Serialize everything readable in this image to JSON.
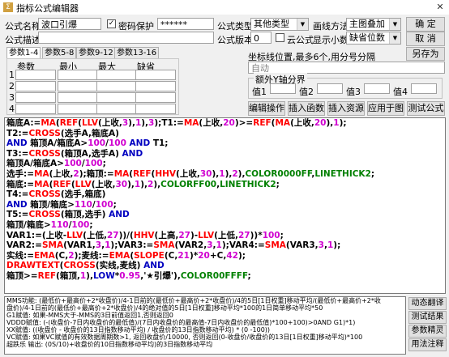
{
  "window": {
    "title": "指标公式编辑器",
    "close": "✕"
  },
  "form": {
    "name_label": "公式名称",
    "name_value": "波口引爆",
    "password_label": "密码保护",
    "password_value": "******",
    "desc_label": "公式描述",
    "desc_value": "",
    "type_label": "公式类型",
    "type_value": "其他类型",
    "draw_label": "画线方法",
    "draw_value": "主图叠加",
    "version_label": "公式版本",
    "version_value": "0",
    "cloud_label": "云公式",
    "decimals_label": "显示小数",
    "decimals_value": "缺省位数"
  },
  "buttons": {
    "ok": "确 定",
    "cancel": "取 消",
    "save_as": "另存为",
    "edit_op": "编辑操作",
    "insert_fn": "插入函数",
    "insert_res": "插入资源",
    "apply_chart": "应用于图",
    "test": "测试公式"
  },
  "tabs": [
    "参数1-4",
    "参数5-8",
    "参数9-12",
    "参数13-16"
  ],
  "params": {
    "headers": [
      "参数",
      "最小",
      "最大",
      "缺省"
    ],
    "rows": [
      "1",
      "2",
      "3",
      "4"
    ]
  },
  "coord": {
    "label": "坐标线位置,最多6个,用分号分隔",
    "value": "自动"
  },
  "extra_y": {
    "label": "额外Y轴分界",
    "values": [
      "值1",
      "值2",
      "值3",
      "值4"
    ]
  },
  "code_lines": [
    [
      [
        "blk",
        "箱底A:="
      ],
      [
        "fn",
        "MA"
      ],
      [
        "blk",
        "("
      ],
      [
        "fn",
        "REF"
      ],
      [
        "blk",
        "("
      ],
      [
        "fn",
        "LLV"
      ],
      [
        "blk",
        "(上收,"
      ],
      [
        "num",
        "3"
      ],
      [
        "blk",
        "),"
      ],
      [
        "num",
        "1"
      ],
      [
        "blk",
        "),"
      ],
      [
        "num",
        "3"
      ],
      [
        "blk",
        ");T1:="
      ],
      [
        "fn",
        "MA"
      ],
      [
        "blk",
        "(上收,"
      ],
      [
        "num",
        "20"
      ],
      [
        "blk",
        ")>="
      ],
      [
        "fn",
        "REF"
      ],
      [
        "blk",
        "("
      ],
      [
        "fn",
        "MA"
      ],
      [
        "blk",
        "(上收,"
      ],
      [
        "num",
        "20"
      ],
      [
        "blk",
        "),"
      ],
      [
        "num",
        "1"
      ],
      [
        "blk",
        ");"
      ]
    ],
    [
      [
        "blk",
        "T2:="
      ],
      [
        "fn",
        "CROSS"
      ],
      [
        "blk",
        "(选手A,箱底A)"
      ]
    ],
    [
      [
        "kw",
        "AND"
      ],
      [
        "blk",
        " 箱顶A/箱底A>"
      ],
      [
        "num",
        "100"
      ],
      [
        "blk",
        "/"
      ],
      [
        "num",
        "100"
      ],
      [
        "blk",
        " "
      ],
      [
        "kw",
        "AND"
      ],
      [
        "blk",
        " T1;"
      ]
    ],
    [
      [
        "blk",
        "T3:="
      ],
      [
        "fn",
        "CROSS"
      ],
      [
        "blk",
        "(箱顶A,选手A) "
      ],
      [
        "kw",
        "AND"
      ]
    ],
    [
      [
        "blk",
        "箱顶A/箱底A>"
      ],
      [
        "num",
        "100"
      ],
      [
        "blk",
        "/"
      ],
      [
        "num",
        "100"
      ],
      [
        "blk",
        ";"
      ]
    ],
    [
      [
        "blk",
        "选手:="
      ],
      [
        "fn",
        "MA"
      ],
      [
        "blk",
        "(上收,"
      ],
      [
        "num",
        "2"
      ],
      [
        "blk",
        ");箱顶:="
      ],
      [
        "fn",
        "MA"
      ],
      [
        "blk",
        "("
      ],
      [
        "fn",
        "REF"
      ],
      [
        "blk",
        "("
      ],
      [
        "fn",
        "HHV"
      ],
      [
        "blk",
        "(上收,"
      ],
      [
        "num",
        "30"
      ],
      [
        "blk",
        "),"
      ],
      [
        "num",
        "1"
      ],
      [
        "blk",
        "),"
      ],
      [
        "num",
        "2"
      ],
      [
        "blk",
        "),"
      ],
      [
        "grn",
        "COLOR0000FF"
      ],
      [
        "blk",
        ","
      ],
      [
        "grn",
        "LINETHICK2"
      ],
      [
        "blk",
        ";"
      ]
    ],
    [
      [
        "blk",
        "箱底:="
      ],
      [
        "fn",
        "MA"
      ],
      [
        "blk",
        "("
      ],
      [
        "fn",
        "REF"
      ],
      [
        "blk",
        "("
      ],
      [
        "fn",
        "LLV"
      ],
      [
        "blk",
        "(上收,"
      ],
      [
        "num",
        "30"
      ],
      [
        "blk",
        "),"
      ],
      [
        "num",
        "1"
      ],
      [
        "blk",
        "),"
      ],
      [
        "num",
        "2"
      ],
      [
        "blk",
        "),"
      ],
      [
        "grn",
        "COLORFF00"
      ],
      [
        "blk",
        ","
      ],
      [
        "grn",
        "LINETHICK2"
      ],
      [
        "blk",
        ";"
      ]
    ],
    [
      [
        "blk",
        "T4:="
      ],
      [
        "fn",
        "CROSS"
      ],
      [
        "blk",
        "(选手,箱底)"
      ]
    ],
    [
      [
        "kw",
        "AND"
      ],
      [
        "blk",
        " 箱顶/箱底>"
      ],
      [
        "num",
        "110"
      ],
      [
        "blk",
        "/"
      ],
      [
        "num",
        "100"
      ],
      [
        "blk",
        ";"
      ]
    ],
    [
      [
        "blk",
        "T5:="
      ],
      [
        "fn",
        "CROSS"
      ],
      [
        "blk",
        "(箱顶,选手) "
      ],
      [
        "kw",
        "AND"
      ]
    ],
    [
      [
        "blk",
        "箱顶/箱底>"
      ],
      [
        "num",
        "110"
      ],
      [
        "blk",
        "/"
      ],
      [
        "num",
        "100"
      ],
      [
        "blk",
        ";"
      ]
    ],
    [
      [
        "blk",
        "VAR1:=(上收-"
      ],
      [
        "fn",
        "LLV"
      ],
      [
        "blk",
        "(上低,"
      ],
      [
        "num",
        "27"
      ],
      [
        "blk",
        "))/("
      ],
      [
        "fn",
        "HHV"
      ],
      [
        "blk",
        "(上高,"
      ],
      [
        "num",
        "27"
      ],
      [
        "blk",
        ")-"
      ],
      [
        "fn",
        "LLV"
      ],
      [
        "blk",
        "(上低,"
      ],
      [
        "num",
        "27"
      ],
      [
        "blk",
        "))*"
      ],
      [
        "num",
        "100"
      ],
      [
        "blk",
        ";"
      ]
    ],
    [
      [
        "blk",
        "VAR2:="
      ],
      [
        "fn",
        "SMA"
      ],
      [
        "blk",
        "(VAR1,"
      ],
      [
        "num",
        "3"
      ],
      [
        "blk",
        ","
      ],
      [
        "num",
        "1"
      ],
      [
        "blk",
        ");VAR3:="
      ],
      [
        "fn",
        "SMA"
      ],
      [
        "blk",
        "(VAR2,"
      ],
      [
        "num",
        "3"
      ],
      [
        "blk",
        ","
      ],
      [
        "num",
        "1"
      ],
      [
        "blk",
        ");VAR4:="
      ],
      [
        "fn",
        "SMA"
      ],
      [
        "blk",
        "(VAR3,"
      ],
      [
        "num",
        "3"
      ],
      [
        "blk",
        ","
      ],
      [
        "num",
        "1"
      ],
      [
        "blk",
        ");"
      ]
    ],
    [
      [
        "blk",
        "实线:="
      ],
      [
        "fn",
        "EMA"
      ],
      [
        "blk",
        "(C,"
      ],
      [
        "num",
        "2"
      ],
      [
        "blk",
        ");麦线:="
      ],
      [
        "fn",
        "EMA"
      ],
      [
        "blk",
        "("
      ],
      [
        "fn",
        "SLOPE"
      ],
      [
        "blk",
        "(C,"
      ],
      [
        "num",
        "21"
      ],
      [
        "blk",
        ")*"
      ],
      [
        "num",
        "20"
      ],
      [
        "blk",
        "+C,"
      ],
      [
        "num",
        "42"
      ],
      [
        "blk",
        ");"
      ]
    ],
    [
      [
        "fn",
        "DRAWTEXT"
      ],
      [
        "blk",
        "("
      ],
      [
        "fn",
        "CROSS"
      ],
      [
        "blk",
        "(实线,麦线) "
      ],
      [
        "kw",
        "AND"
      ]
    ],
    [
      [
        "blk",
        "箱顶>="
      ],
      [
        "fn",
        "REF"
      ],
      [
        "blk",
        "(箱顶,"
      ],
      [
        "num",
        "1"
      ],
      [
        "blk",
        "),"
      ],
      [
        "kw",
        "LOW"
      ],
      [
        "blk",
        "*"
      ],
      [
        "num",
        "0.95"
      ],
      [
        "blk",
        ",'★引爆'),"
      ],
      [
        "grn",
        "COLOR00FFFF"
      ],
      [
        "blk",
        ";"
      ]
    ]
  ],
  "help_lines": [
    "MMS功能: (最低价+最高价+2*收盘价)/4-1日前的(最低价+最高价+2*收盘价)/4的5日[1日权重]移动平均/(最低价+最高价+2*收",
    "盘价)/4-1日前的(最低价+最高价+2*收盘价)/4的绝对值的5日[1日权重]移动平均*100的1日简单移动平均*50",
    "G1赋值: 如果-MMS大于-MMS的3日前值返回1,否则返回0",
    "VDDD赋值: (-(收盘价-7日内收盘价的最低值)/(7日内收盘价的最高值-7日内收盘价的最低值)*100+100)>0AND G1)*1)",
    "XX赋值: ((收盘价 - 收盘价的13日指数移动平均) / 收盘价的13日指数移动平均) * (0 -100))",
    "VC赋值: 如果VC赋值的有效数据周期数>1, 返回收盘价/10000, 否则返回(0-收盘价/收盘价的13日[1日权重]移动平均)*100",
    "超跌乐 输出: (0S/10)+收盘价的10日指数移动平均)的3日指数移动平均"
  ],
  "side_buttons": [
    "动态翻译",
    "测试结果",
    "参数精灵",
    "用法注释"
  ]
}
